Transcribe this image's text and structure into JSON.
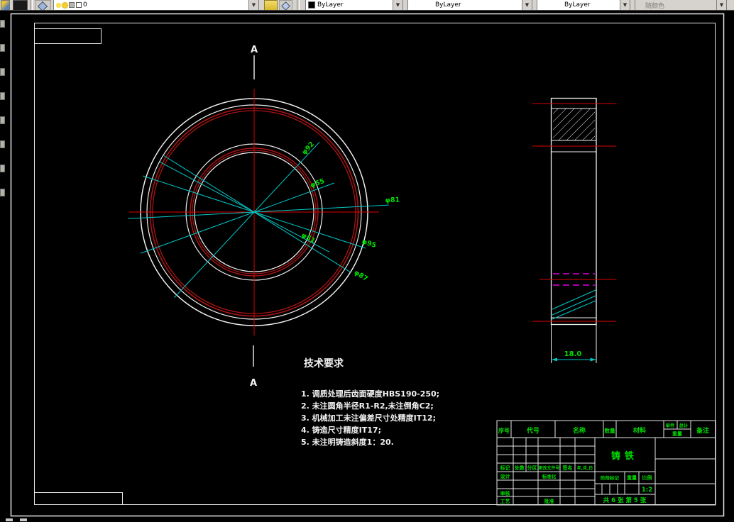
{
  "toolbar": {
    "layer_value": "0",
    "color_value": "ByLayer",
    "linetype_value": "ByLayer",
    "lineweight_value": "ByLayer",
    "plot_style_value": "随颜色"
  },
  "drawing": {
    "section_label_top": "A",
    "section_label_bottom": "A",
    "front_dims": [
      "φ92",
      "φ55",
      "φ81",
      "φ51",
      "φ95",
      "φ87"
    ],
    "side_width_dim": "18.0",
    "tech_requirements": {
      "title": "技术要求",
      "line1": "1. 调质处理后齿面硬度HBS190-250;",
      "line2": "2. 未注圆角半径R1-R2,未注倒角C2;",
      "line3": "3. 机械加工未注偏差尺寸处精度IT12;",
      "line4": "4. 铸造尺寸精度IT17;",
      "line5": "5. 未注明铸造斜度1：20."
    },
    "colors": {
      "background": "#000000",
      "outline": "#f0f0f0",
      "centerline": "#dd0000",
      "dimension_line": "#00c8c8",
      "dimension_text": "#00dd00",
      "hidden_line": "#bb00bb"
    }
  },
  "title_block": {
    "col_serial": "序号",
    "col_code": "代号",
    "col_name": "名称",
    "col_qty": "数量",
    "col_material": "材料",
    "col_single": "单件",
    "col_total": "总计",
    "col_weight": "重量",
    "col_remarks": "备注",
    "material_value": "铸铁",
    "row_mark": "标记",
    "row_count": "处数",
    "row_zone": "分区",
    "row_change_file": "更改文件号",
    "row_sign": "签名",
    "row_date": "年,月,日",
    "role_design": "设计",
    "role_standardization": "标准化",
    "role_review": "审核",
    "role_process": "工艺",
    "role_approve": "批准",
    "stage_mark": "阶段标记",
    "weight_label": "重量",
    "scale_label": "比例",
    "scale_value": "1:2",
    "sheet_info": "共 6 张 第 5 张"
  }
}
